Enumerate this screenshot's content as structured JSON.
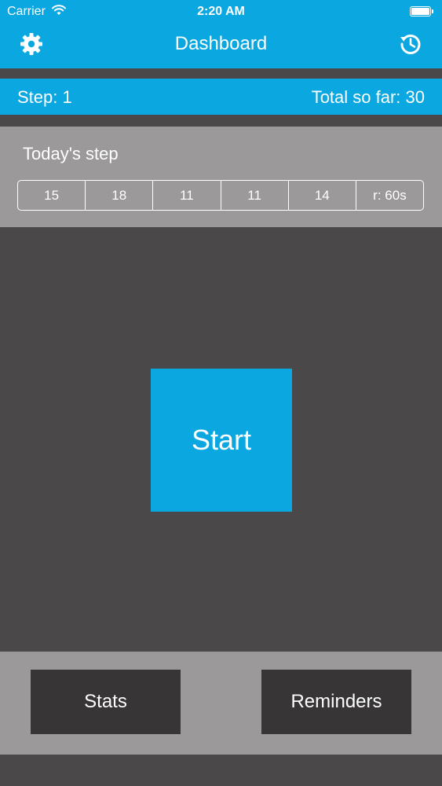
{
  "status_bar": {
    "carrier": "Carrier",
    "time": "2:20 AM",
    "wifi_icon": "wifi-icon",
    "battery_icon": "battery-icon"
  },
  "nav": {
    "title": "Dashboard",
    "left_icon": "gear-icon",
    "right_icon": "history-icon"
  },
  "step_bar": {
    "step_label": "Step: 1",
    "total_label": "Total so far: 30"
  },
  "today": {
    "label": "Today's step",
    "segments": [
      "15",
      "18",
      "11",
      "11",
      "14",
      "r: 60s"
    ]
  },
  "main": {
    "start_label": "Start"
  },
  "bottom": {
    "stats_label": "Stats",
    "reminders_label": "Reminders"
  },
  "colors": {
    "accent": "#0aa7e0",
    "background": "#4a4849",
    "panel": "#9b999a",
    "button": "#373536"
  }
}
